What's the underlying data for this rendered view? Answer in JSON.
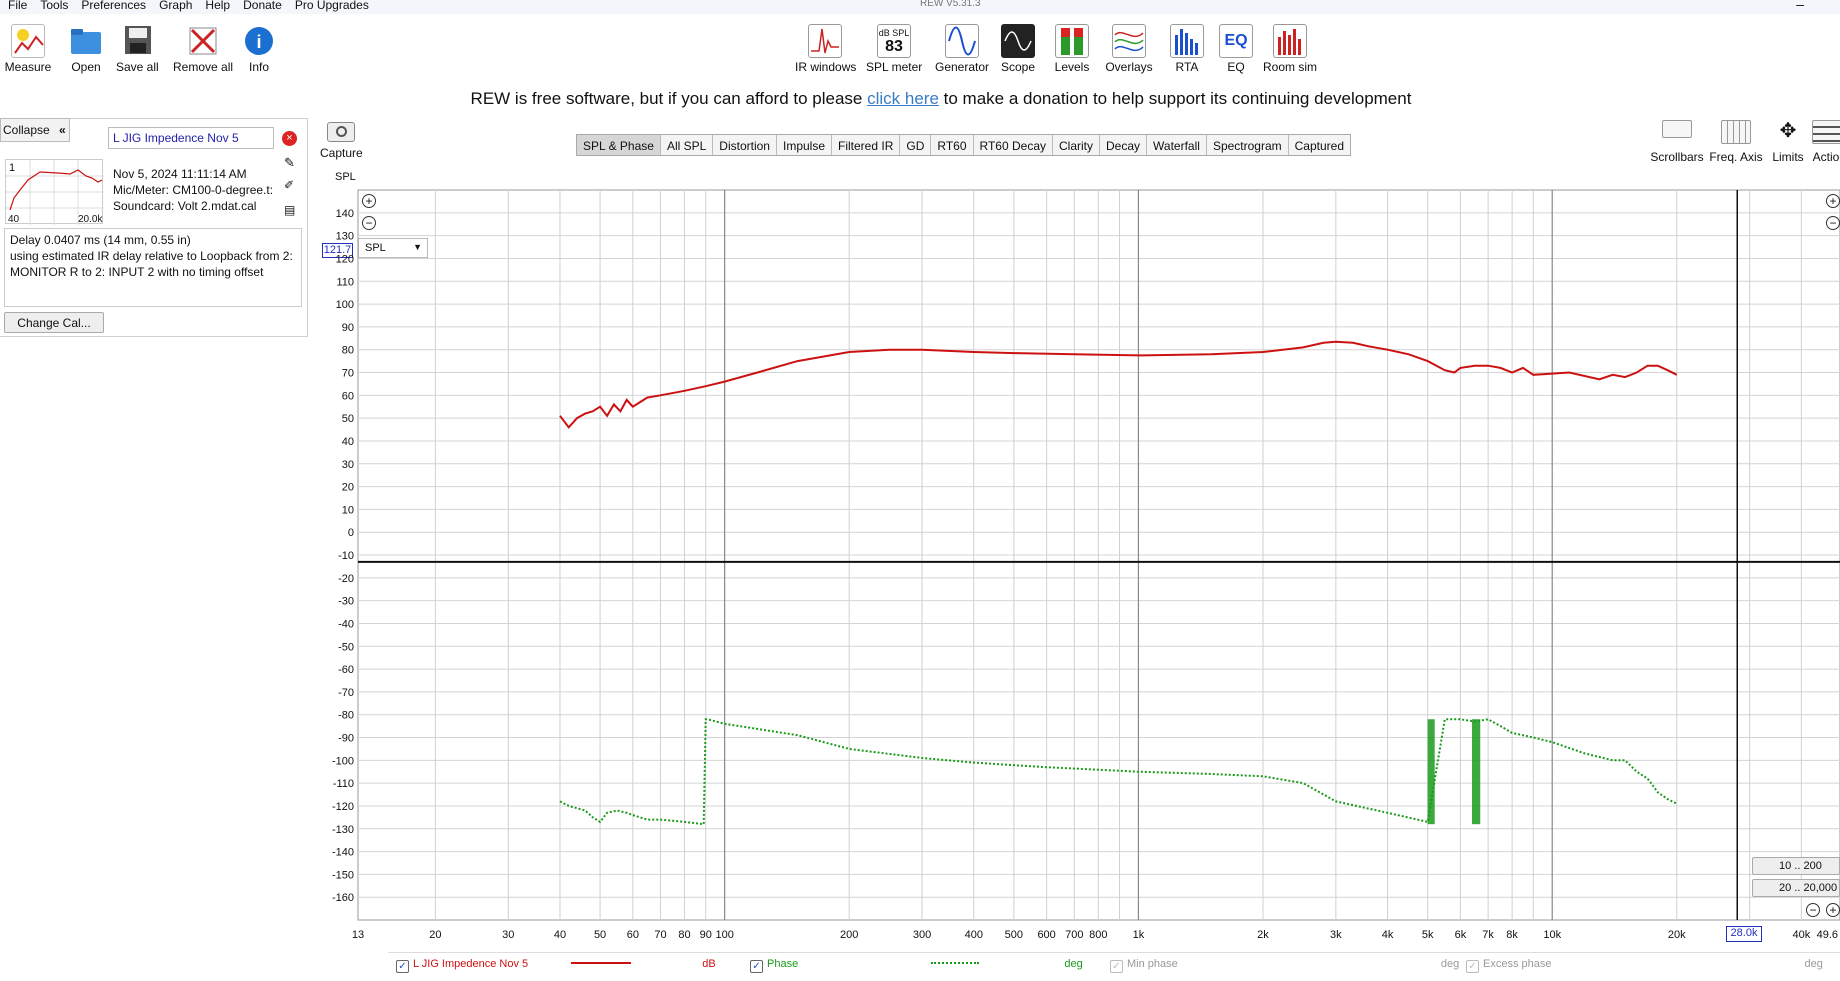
{
  "window": {
    "title": "REW V5.31.3",
    "close": "–"
  },
  "menu": [
    "File",
    "Tools",
    "Preferences",
    "Graph",
    "Help",
    "Donate",
    "Pro Upgrades"
  ],
  "toolbar": {
    "measure": "Measure",
    "open": "Open",
    "save_all": "Save all",
    "remove_all": "Remove all",
    "info": "Info",
    "ir_windows": "IR windows",
    "spl_meter": "SPL meter",
    "spl_meter_icon_top": "dB SPL",
    "spl_meter_icon_value": "83",
    "generator": "Generator",
    "scope": "Scope",
    "levels": "Levels",
    "overlays": "Overlays",
    "rta": "RTA",
    "eq": "EQ",
    "eq_icon": "EQ",
    "room_sim": "Room sim"
  },
  "banner": {
    "before": "REW is free software, but if you can afford to please ",
    "link": "click here",
    "after": " to make a donation to help support its continuing development"
  },
  "left_panel": {
    "collapse": "Collapse",
    "measurement_name": "L JIG Impedence Nov 5",
    "thumb_index": "1",
    "thumb_x_min": "40",
    "thumb_x_max": "20.0k",
    "date": "Nov 5, 2024 11:11:14 AM",
    "mic": "Mic/Meter: CM100-0-degree.t:",
    "soundcard": "Soundcard: Volt 2.mdat.cal",
    "delay_line1": "Delay 0.0407 ms (14 mm, 0.55 in)",
    "delay_line2": "using estimated IR delay relative to Loopback from 2:",
    "delay_line3": "MONITOR R to 2: INPUT 2 with no timing offset",
    "change_cal": "Change Cal..."
  },
  "tabs": [
    "SPL & Phase",
    "All SPL",
    "Distortion",
    "Impulse",
    "Filtered IR",
    "GD",
    "RT60",
    "RT60 Decay",
    "Clarity",
    "Decay",
    "Waterfall",
    "Spectrogram",
    "Captured"
  ],
  "graph_controls": {
    "capture": "Capture",
    "scrollbars": "Scrollbars",
    "freq_axis": "Freq. Axis",
    "limits": "Limits",
    "actions": "Actio",
    "spl_label": "SPL",
    "y_top_box": "121.7",
    "spl_dropdown": "SPL",
    "range1": "10 .. 200",
    "range2": "20 .. 20,000",
    "freq_box": "28.0k"
  },
  "chart_data": {
    "type": "line",
    "xscale": "log",
    "xlim": [
      13,
      49600
    ],
    "ylim": [
      -170,
      150
    ],
    "y_ticks": [
      140,
      130,
      120,
      110,
      100,
      90,
      80,
      70,
      60,
      50,
      40,
      30,
      20,
      10,
      0,
      -10,
      -20,
      -30,
      -40,
      -50,
      -60,
      -70,
      -80,
      -90,
      -100,
      -110,
      -120,
      -130,
      -140,
      -150,
      -160
    ],
    "x_tick_labels": [
      "13",
      "20",
      "30",
      "40",
      "50",
      "60",
      "70",
      "80",
      "90",
      "100",
      "200",
      "300",
      "400",
      "500",
      "600",
      "700",
      "800",
      "1k",
      "2k",
      "3k",
      "4k",
      "5k",
      "6k",
      "7k",
      "8k",
      "10k",
      "20k",
      "40k",
      "49.6"
    ],
    "x_tick_values": [
      13,
      20,
      30,
      40,
      50,
      60,
      70,
      80,
      90,
      100,
      200,
      300,
      400,
      500,
      600,
      700,
      800,
      1000,
      2000,
      3000,
      4000,
      5000,
      6000,
      7000,
      8000,
      10000,
      20000,
      40000,
      49600
    ],
    "series": [
      {
        "name": "L JIG Impedence Nov 5",
        "unit": "dB",
        "color": "#cc1111",
        "style": "solid",
        "x": [
          40,
          42,
          44,
          46,
          48,
          50,
          52,
          54,
          56,
          58,
          60,
          65,
          70,
          80,
          90,
          100,
          120,
          150,
          200,
          250,
          300,
          400,
          500,
          700,
          1000,
          1500,
          2000,
          2500,
          2800,
          3000,
          3300,
          3600,
          4000,
          4500,
          5000,
          5500,
          5800,
          6000,
          6500,
          7000,
          7500,
          8000,
          8500,
          9000,
          10000,
          11000,
          13000,
          14000,
          15000,
          16000,
          17000,
          18000,
          19000,
          20000
        ],
        "values": [
          51,
          46,
          50,
          52,
          53,
          55,
          51,
          56,
          53,
          58,
          55,
          59,
          60,
          62,
          64,
          66,
          70,
          75,
          79,
          80,
          80,
          79,
          78.5,
          78,
          77.5,
          78,
          79,
          81,
          83,
          83.5,
          83,
          81.5,
          80,
          78,
          75,
          71,
          70,
          72,
          73,
          73,
          72,
          70,
          72,
          69,
          69.5,
          70,
          67,
          69,
          68,
          70,
          73,
          73,
          71,
          69
        ]
      },
      {
        "name": "Phase",
        "unit": "deg",
        "color": "#1a9a1a",
        "style": "dotted",
        "x": [
          40,
          42,
          44,
          46,
          48,
          50,
          52,
          55,
          58,
          60,
          65,
          70,
          80,
          89,
          90,
          91,
          100,
          150,
          200,
          300,
          400,
          600,
          1000,
          1500,
          2000,
          2500,
          3000,
          4000,
          5000,
          5500,
          6000,
          6500,
          7000,
          7500,
          8000,
          9000,
          10000,
          12000,
          14000,
          15000,
          16000,
          17000,
          18000,
          19000,
          20000
        ],
        "values": [
          -118,
          -120,
          -121,
          -122,
          -125,
          -127,
          -123,
          -122,
          -123,
          -124,
          -126,
          -126,
          -127,
          -128,
          -82,
          -82,
          -84,
          -89,
          -95,
          -99,
          -101,
          -103,
          -105,
          -106,
          -107,
          -110,
          -118,
          -123,
          -127,
          -82,
          -82,
          -83,
          -82,
          -85,
          -88,
          -90,
          -92,
          -97,
          -100,
          -100,
          -105,
          -108,
          -114,
          -117,
          -119
        ]
      }
    ],
    "phase_wrap_bands_hz": [
      [
        5000,
        5200
      ],
      [
        6400,
        6700
      ]
    ],
    "marker_line_y": -13
  },
  "legend": {
    "item1_name": "L JIG Impedence Nov 5",
    "item1_unit": "dB",
    "item2_name": "Phase",
    "item2_unit": "deg",
    "item3_name": "Min phase",
    "item3_unit": "deg",
    "item4_name": "Excess phase",
    "item4_unit": "deg"
  },
  "colors": {
    "spl": "#cc1111",
    "phase": "#1a9a1a",
    "link": "#3a7cc4",
    "accent_box": "#2230c0"
  }
}
